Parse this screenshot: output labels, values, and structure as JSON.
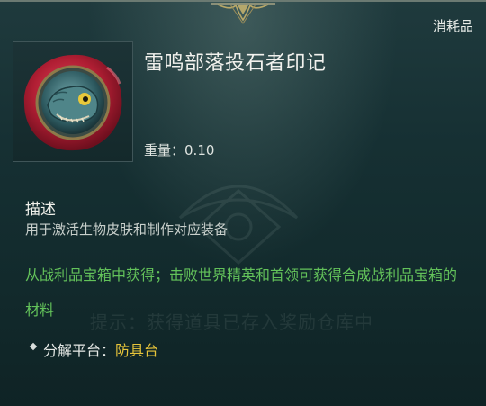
{
  "item": {
    "category": "消耗品",
    "name": "雷鸣部落投石者印记",
    "weight_label": "重量：",
    "weight_value": "0.10",
    "icon": "wax-seal-lizard-icon"
  },
  "description": {
    "heading": "描述",
    "body": "用于激活生物皮肤和制作对应装备"
  },
  "source": {
    "text": "从战利品宝箱中获得；击败世界精英和首领可获得合成战利品宝箱的材料"
  },
  "hint": {
    "text": "提示：获得道具已存入奖励仓库中"
  },
  "dismantle": {
    "label": "分解平台：",
    "value": "防具台"
  },
  "colors": {
    "source_green": "#63c25a",
    "value_gold": "#e6c43a",
    "background": "#163033"
  }
}
